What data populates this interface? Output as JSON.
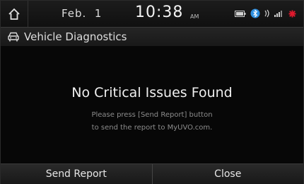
{
  "status_bar": {
    "date": "Feb.  1",
    "time": "10:38",
    "ampm": "AM",
    "icons": [
      "battery-icon",
      "bluetooth-icon",
      "signal-icon",
      "alert-star-icon"
    ]
  },
  "header": {
    "icon": "vehicle-icon",
    "title": "Vehicle Diagnostics"
  },
  "main": {
    "headline": "No Critical Issues Found",
    "message_line1": "Please press [Send Report] button",
    "message_line2": "to send the report to MyUVO.com."
  },
  "buttons": {
    "send_report": "Send Report",
    "close": "Close"
  },
  "colors": {
    "alert": "#e0192d",
    "accent_blue": "#2e8fe0"
  }
}
